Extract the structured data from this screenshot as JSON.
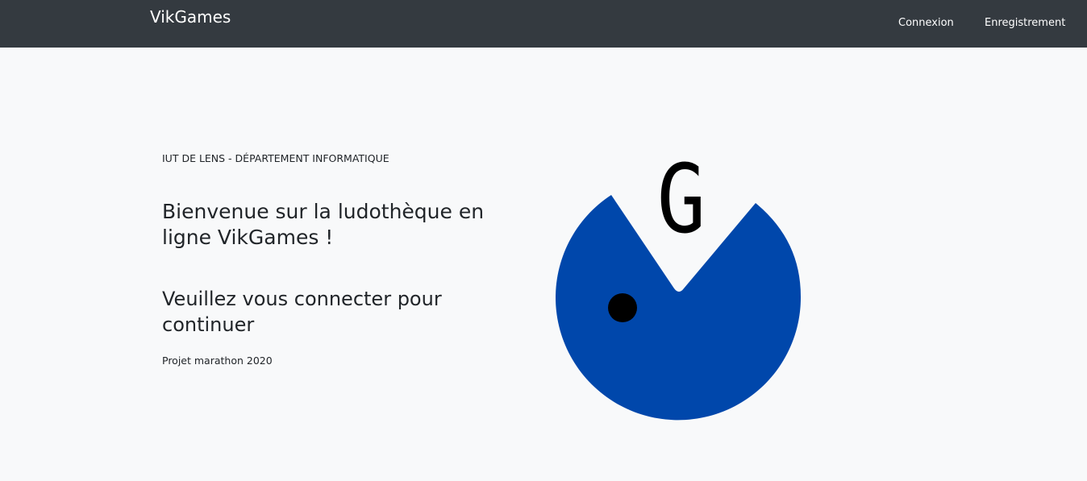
{
  "navbar": {
    "brand": "VikGames",
    "links": [
      {
        "label": "Connexion"
      },
      {
        "label": "Enregistrement"
      }
    ]
  },
  "hero": {
    "eyebrow": "IUT DE LENS - DÉPARTEMENT INFORMATIQUE",
    "welcome": "Bienvenue sur la ludothèque en ligne VikGames !",
    "connect": "Veuillez vous connecter pour continuer",
    "footer_note": "Projet marathon 2020"
  },
  "logo": {
    "letter": "G",
    "body_color": "#0047ab",
    "eye_color": "#000000",
    "letter_color": "#000000"
  },
  "colors": {
    "navbar_bg": "#343a40",
    "page_bg": "#f8f9fa",
    "text": "#212529"
  }
}
